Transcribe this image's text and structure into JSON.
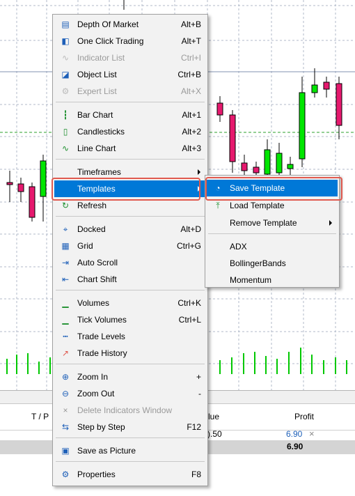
{
  "context_menu": {
    "items": [
      {
        "label": "Depth Of Market",
        "shortcut": "Alt+B",
        "icon": "depth-of-market-icon",
        "disabled": false
      },
      {
        "label": "One Click Trading",
        "shortcut": "Alt+T",
        "icon": "one-click-trading-icon",
        "disabled": false
      },
      {
        "label": "Indicator List",
        "shortcut": "Ctrl+I",
        "icon": "indicator-list-icon",
        "disabled": true
      },
      {
        "label": "Object List",
        "shortcut": "Ctrl+B",
        "icon": "object-list-icon",
        "disabled": false
      },
      {
        "label": "Expert List",
        "shortcut": "Alt+X",
        "icon": "expert-list-icon",
        "disabled": true
      },
      {
        "label": "Bar Chart",
        "shortcut": "Alt+1",
        "icon": "bar-chart-icon",
        "disabled": false
      },
      {
        "label": "Candlesticks",
        "shortcut": "Alt+2",
        "icon": "candlesticks-icon",
        "disabled": false
      },
      {
        "label": "Line Chart",
        "shortcut": "Alt+3",
        "icon": "line-chart-icon",
        "disabled": false
      },
      {
        "label": "Timeframes",
        "shortcut": "",
        "icon": "",
        "disabled": false,
        "submenu": true
      },
      {
        "label": "Templates",
        "shortcut": "",
        "icon": "",
        "disabled": false,
        "submenu": true,
        "highlighted": true
      },
      {
        "label": "Refresh",
        "shortcut": "",
        "icon": "refresh-icon",
        "disabled": false
      },
      {
        "label": "Docked",
        "shortcut": "Alt+D",
        "icon": "docked-icon",
        "disabled": false
      },
      {
        "label": "Grid",
        "shortcut": "Ctrl+G",
        "icon": "grid-icon",
        "disabled": false
      },
      {
        "label": "Auto Scroll",
        "shortcut": "",
        "icon": "auto-scroll-icon",
        "disabled": false
      },
      {
        "label": "Chart Shift",
        "shortcut": "",
        "icon": "chart-shift-icon",
        "disabled": false
      },
      {
        "label": "Volumes",
        "shortcut": "Ctrl+K",
        "icon": "volumes-icon",
        "disabled": false
      },
      {
        "label": "Tick Volumes",
        "shortcut": "Ctrl+L",
        "icon": "tick-volumes-icon",
        "disabled": false
      },
      {
        "label": "Trade Levels",
        "shortcut": "",
        "icon": "trade-levels-icon",
        "disabled": false
      },
      {
        "label": "Trade History",
        "shortcut": "",
        "icon": "trade-history-icon",
        "disabled": false
      },
      {
        "label": "Zoom In",
        "shortcut": "+",
        "icon": "zoom-in-icon",
        "disabled": false
      },
      {
        "label": "Zoom Out",
        "shortcut": "-",
        "icon": "zoom-out-icon",
        "disabled": false
      },
      {
        "label": "Delete Indicators Window",
        "shortcut": "",
        "icon": "close-icon",
        "disabled": true
      },
      {
        "label": "Step by Step",
        "shortcut": "F12",
        "icon": "step-by-step-icon",
        "disabled": false
      },
      {
        "label": "Save as Picture",
        "shortcut": "",
        "icon": "save-picture-icon",
        "disabled": false
      },
      {
        "label": "Properties",
        "shortcut": "F8",
        "icon": "gear-icon",
        "disabled": false
      }
    ]
  },
  "templates_submenu": {
    "items": [
      {
        "label": "Save Template",
        "icon": "save-template-icon",
        "highlighted": true
      },
      {
        "label": "Load Template",
        "icon": "load-template-icon"
      },
      {
        "label": "Remove Template",
        "icon": "",
        "submenu": true
      },
      {
        "label": "ADX",
        "icon": ""
      },
      {
        "label": "BollingerBands",
        "icon": ""
      },
      {
        "label": "Momentum",
        "icon": ""
      }
    ]
  },
  "terminal": {
    "headers": {
      "tp": "T / P",
      "value": "lue",
      "profit": "Profit"
    },
    "row": {
      "value": ").50",
      "profit": "6.90",
      "close": "×"
    },
    "total": {
      "profit": "6.90"
    }
  },
  "colors": {
    "highlight": "#0078d7",
    "bull": "#00e600",
    "bear": "#e6196e",
    "volume": "#00c800",
    "annotation": "#e05a4f"
  }
}
